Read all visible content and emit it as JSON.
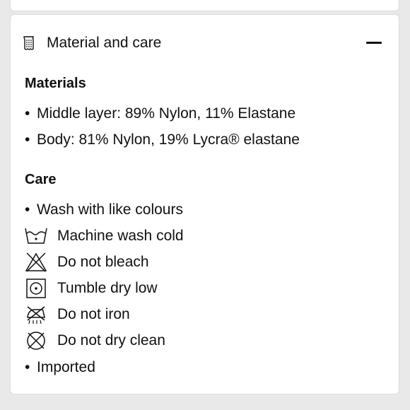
{
  "accordion": {
    "title": "Material and care",
    "header_icon": "fabric-swatch-icon",
    "toggle_icon": "minus-icon"
  },
  "materials": {
    "heading": "Materials",
    "items": [
      "Middle layer: 89% Nylon, 11% Elastane",
      "Body: 81% Nylon, 19% Lycra® elastane"
    ]
  },
  "care": {
    "heading": "Care",
    "bullet_top": "Wash with like colours",
    "instructions": [
      {
        "icon": "wash-cold-icon",
        "label": "Machine wash cold"
      },
      {
        "icon": "no-bleach-icon",
        "label": "Do not bleach"
      },
      {
        "icon": "tumble-dry-low-icon",
        "label": "Tumble dry low"
      },
      {
        "icon": "no-iron-icon",
        "label": "Do not iron"
      },
      {
        "icon": "no-dry-clean-icon",
        "label": "Do not dry clean"
      }
    ],
    "bullet_bottom": "Imported"
  },
  "colors": {
    "page_background": "#e9e9ea",
    "card_background": "#ffffff",
    "text": "#111111",
    "border": "#dcdcdc"
  }
}
